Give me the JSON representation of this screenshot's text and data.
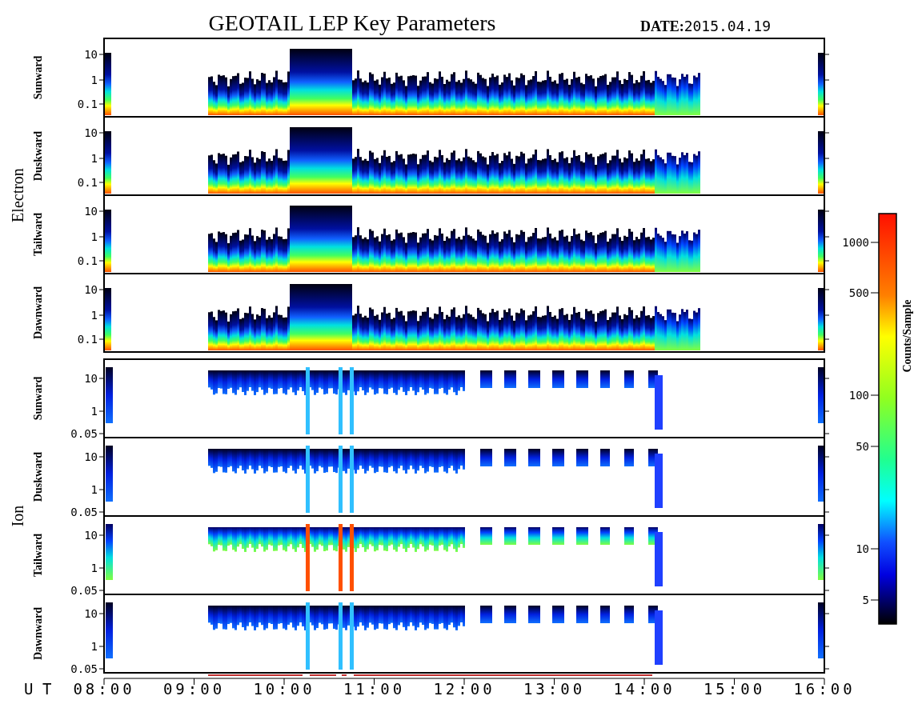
{
  "title": "GEOTAIL LEP Key Parameters",
  "date_label": "DATE:",
  "date": "2015.04.19",
  "groups": [
    {
      "label": "Electron",
      "kind": "electron",
      "panels": [
        {
          "label": "Sunward",
          "yticks": [
            "10",
            "1",
            "0.1"
          ]
        },
        {
          "label": "Duskward",
          "yticks": [
            "10",
            "1",
            "0.1"
          ]
        },
        {
          "label": "Tailward",
          "yticks": [
            "10",
            "1",
            "0.1"
          ]
        },
        {
          "label": "Dawnward",
          "yticks": [
            "10",
            "1",
            "0.1"
          ]
        }
      ]
    },
    {
      "label": "Ion",
      "kind": "ion",
      "panels": [
        {
          "label": "Sunward",
          "yticks": [
            "10",
            "1",
            "0.05"
          ]
        },
        {
          "label": "Duskward",
          "yticks": [
            "10",
            "1",
            "0.05"
          ]
        },
        {
          "label": "Tailward",
          "yticks": [
            "10",
            "1",
            "0.05"
          ]
        },
        {
          "label": "Dawnward",
          "yticks": [
            "10",
            "1",
            "0.05"
          ]
        }
      ]
    }
  ],
  "time_axis": {
    "label": "U T",
    "ticks": [
      "08:00",
      "09:00",
      "10:00",
      "11:00",
      "12:00",
      "13:00",
      "14:00",
      "15:00",
      "16:00"
    ]
  },
  "colorbar": {
    "label": "Counts/Sample",
    "ticks": [
      "1000",
      "500",
      "100",
      "50",
      "10",
      "5"
    ]
  }
}
